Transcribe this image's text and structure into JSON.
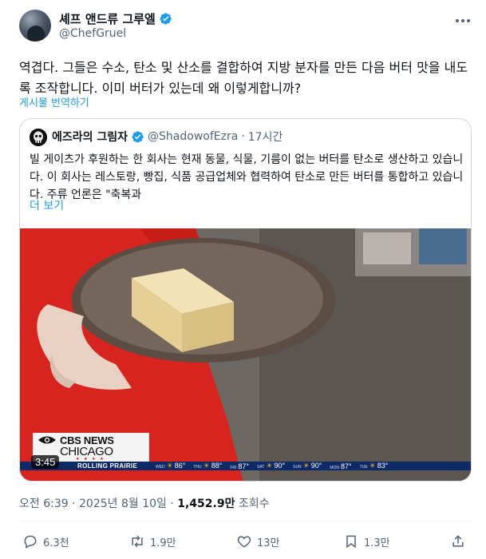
{
  "author": {
    "display_name": "셰프 앤드류 그루엘",
    "handle": "@ChefGruel"
  },
  "tweet": {
    "text": "역겹다. 그들은 수소, 탄소 및 산소를 결합하여 지방 분자를 만든 다음 버터 맛을 내도록 조작합니다. 이미 버터가 있는데 왜 이렇게합니까?",
    "translate_label": "게시물 번역하기"
  },
  "quote": {
    "display_name": "에즈라의 그림자",
    "handle": "@ShadowofEzra",
    "separator": "·",
    "time": "17시간",
    "text": "빌 게이츠가 후원하는 한 회사는 현재 동물, 식물, 기름이 없는 버터를 탄소로 생산하고 있습니다. 이 회사는 레스토랑, 빵집, 식품 공급업체와 협력하여 탄소로 만든 버터를 통합하고 있습니다. 주류 언론은 \"축복과",
    "more_label": "더 보기",
    "video": {
      "duration": "3:45",
      "logo_line1": "CBS NEWS",
      "logo_line2": "CHICAGO",
      "logo_stars": "★ ★ ★ ★",
      "ticker_label": "ROLLING PRAIRIE",
      "weather": [
        {
          "day": "WED",
          "temp": "86°",
          "icon": "sun"
        },
        {
          "day": "THU",
          "temp": "88°",
          "icon": "sun"
        },
        {
          "day": "FRI",
          "temp": "87°",
          "icon": ""
        },
        {
          "day": "SAT",
          "temp": "90°",
          "icon": "sun"
        },
        {
          "day": "SUN",
          "temp": "90°",
          "icon": "sun"
        },
        {
          "day": "MON",
          "temp": "87°",
          "icon": ""
        },
        {
          "day": "TUE",
          "temp": "83°",
          "icon": "sun"
        }
      ]
    }
  },
  "meta": {
    "time": "오전 6:39 · 2025년 8월 10일 · ",
    "views_count": "1,452.9만",
    "views_label": " 조회수"
  },
  "actions": {
    "reply_count": "6.3천",
    "retweet_count": "1.9만",
    "like_count": "13만",
    "bookmark_count": "1.3만"
  },
  "colors": {
    "accent": "#1d9bf0",
    "secondary_text": "#536471",
    "verified": "#1d9bf0"
  }
}
